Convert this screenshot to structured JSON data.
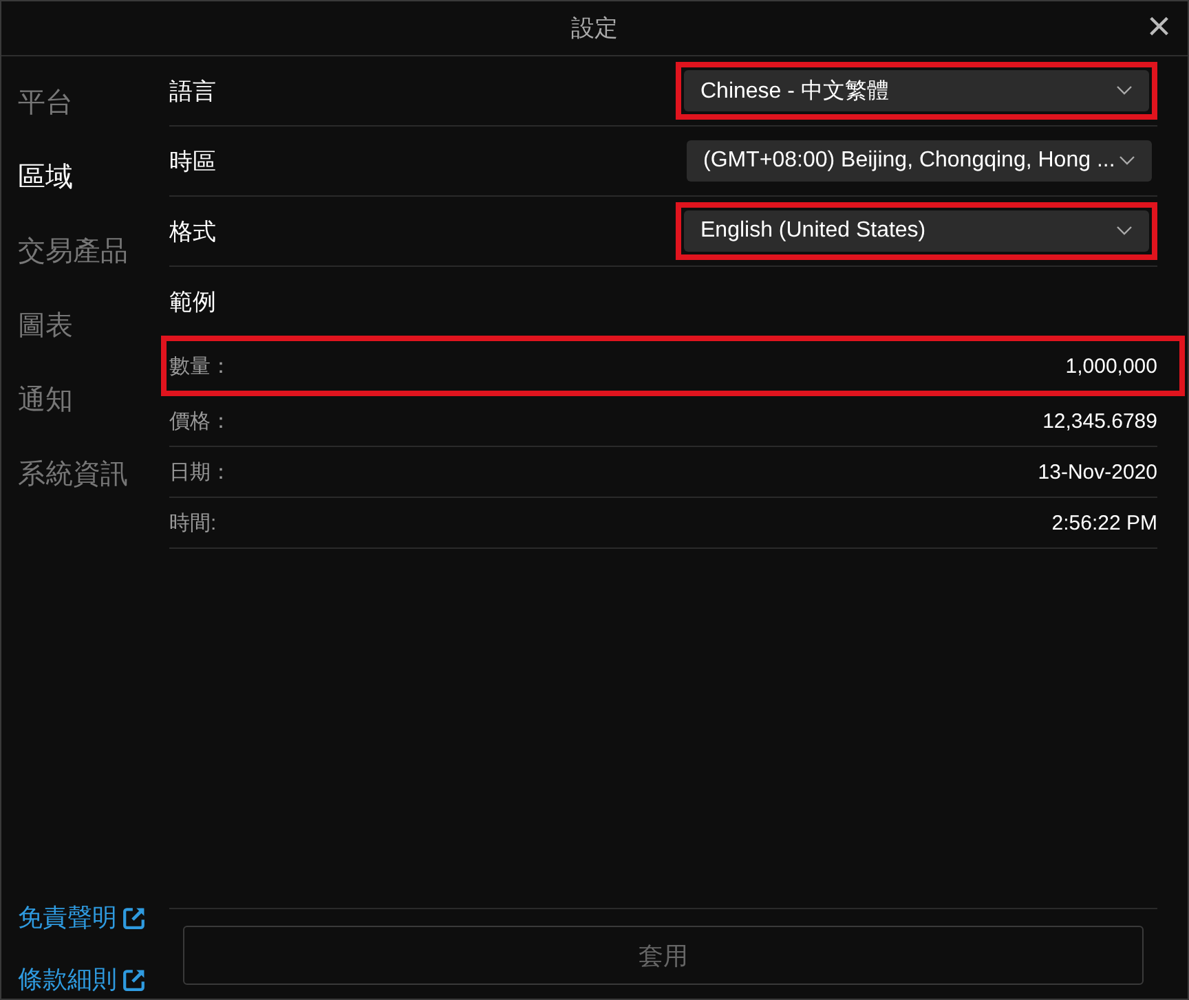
{
  "window": {
    "title": "設定",
    "close": "×"
  },
  "sidebar": {
    "items": [
      {
        "label": "平台",
        "selected": false
      },
      {
        "label": "區域",
        "selected": true
      },
      {
        "label": "交易產品",
        "selected": false
      },
      {
        "label": "圖表",
        "selected": false
      },
      {
        "label": "通知",
        "selected": false
      },
      {
        "label": "系統資訊",
        "selected": false
      }
    ],
    "links": [
      {
        "label": "免責聲明"
      },
      {
        "label": "條款細則"
      }
    ]
  },
  "settings": [
    {
      "label": "語言",
      "value": "Chinese - 中文繁體",
      "highlighted": true
    },
    {
      "label": "時區",
      "value": "(GMT+08:00) Beijing, Chongqing, Hong ...",
      "highlighted": false
    },
    {
      "label": "格式",
      "value": "English (United States)",
      "highlighted": true
    }
  ],
  "example": {
    "title": "範例",
    "rows": [
      {
        "label": "數量：",
        "value": "1,000,000",
        "highlighted": true
      },
      {
        "label": "價格：",
        "value": "12,345.6789",
        "highlighted": false
      },
      {
        "label": "日期：",
        "value": "13-Nov-2020",
        "highlighted": false
      },
      {
        "label": "時間:",
        "value": "2:56:22 PM",
        "highlighted": false
      }
    ]
  },
  "apply_button": {
    "label": "套用",
    "disabled": true
  }
}
